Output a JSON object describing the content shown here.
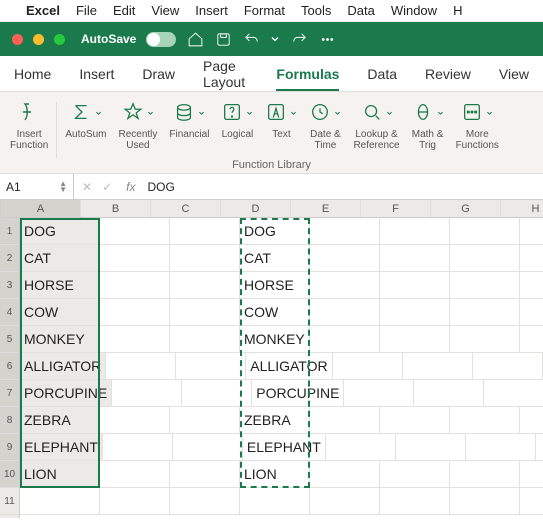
{
  "macMenu": {
    "app": "Excel",
    "items": [
      "File",
      "Edit",
      "View",
      "Insert",
      "Format",
      "Tools",
      "Data",
      "Window",
      "H"
    ]
  },
  "titlebar": {
    "autosave": "AutoSave"
  },
  "tabs": [
    "Home",
    "Insert",
    "Draw",
    "Page Layout",
    "Formulas",
    "Data",
    "Review",
    "View"
  ],
  "activeTab": "Formulas",
  "ribbon": {
    "groups": [
      {
        "name": "insert-function",
        "label": "Insert\nFunction"
      },
      {
        "name": "autosum",
        "label": "AutoSum"
      },
      {
        "name": "recently-used",
        "label": "Recently\nUsed"
      },
      {
        "name": "financial",
        "label": "Financial"
      },
      {
        "name": "logical",
        "label": "Logical"
      },
      {
        "name": "text",
        "label": "Text"
      },
      {
        "name": "date-time",
        "label": "Date &\nTime"
      },
      {
        "name": "lookup-reference",
        "label": "Lookup &\nReference"
      },
      {
        "name": "math-trig",
        "label": "Math &\nTrig"
      },
      {
        "name": "more-functions",
        "label": "More\nFunctions"
      }
    ],
    "sectionLabel": "Function Library"
  },
  "formulaBar": {
    "cellRef": "A1",
    "fx": "fx",
    "value": "DOG"
  },
  "columns": [
    "A",
    "B",
    "C",
    "D",
    "E",
    "F",
    "G",
    "H"
  ],
  "rowCount": 11,
  "cells": {
    "A": [
      "DOG",
      "CAT",
      "HORSE",
      "COW",
      "MONKEY",
      "ALLIGATOR",
      "PORCUPINE",
      "ZEBRA",
      "ELEPHANT",
      "LION"
    ],
    "D": [
      "DOG",
      "CAT",
      "HORSE",
      "COW",
      "MONKEY",
      "ALLIGATOR",
      "PORCUPINE",
      "ZEBRA",
      "ELEPHANT",
      "LION"
    ]
  },
  "selection": {
    "col": "A",
    "startRow": 1,
    "endRow": 10
  },
  "marching": {
    "col": "D",
    "startRow": 1,
    "endRow": 10
  }
}
